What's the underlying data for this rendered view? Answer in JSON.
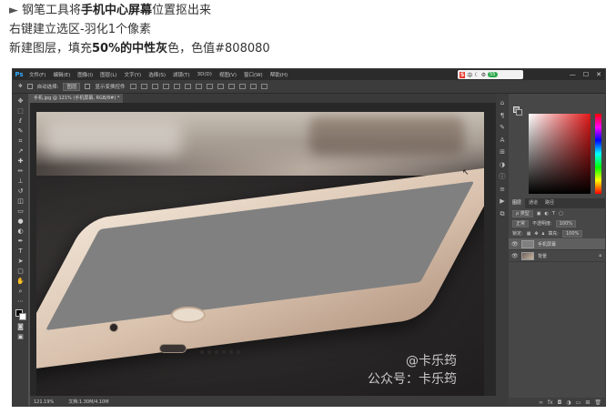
{
  "instructions": {
    "line1_prefix": "钢笔工具将",
    "line1_bold": "手机中心屏幕",
    "line1_suffix": "位置抠出来",
    "line2": "右键建立选区-羽化1个像素",
    "line3_prefix": "新建图层，填充",
    "line3_bold": "50%的中性灰",
    "line3_suffix": "色，色值#808080"
  },
  "app": {
    "logo": "Ps",
    "menu": [
      "文件(F)",
      "编辑(E)",
      "图像(I)",
      "图层(L)",
      "文字(Y)",
      "选择(S)",
      "滤镜(T)",
      "3D(D)",
      "视图(V)",
      "窗口(W)",
      "帮助(H)"
    ],
    "ime_text": "中",
    "ime_badge": "S",
    "ime_bubble": "55"
  },
  "options": {
    "auto_select_label": "自动选择:",
    "auto_select_value": "图层",
    "show_transform": "显示变换控件"
  },
  "document": {
    "tab_title": "手机.jpg @ 121% (手机屏幕, RGB/8#) *",
    "zoom": "121.19%",
    "doc_size": "文档:1.30M/4.10M"
  },
  "watermark": {
    "line1": "@卡乐筠",
    "line2": "公众号：卡乐筠"
  },
  "layers_panel": {
    "tabs": [
      "图层",
      "通道",
      "路径"
    ],
    "kind_label": "ρ 类型",
    "blend_mode": "正常",
    "opacity_label": "不透明度:",
    "opacity_value": "100%",
    "lock_label": "锁定:",
    "fill_label": "填充:",
    "fill_value": "100%",
    "layers": [
      {
        "name": "手机屏幕",
        "active": true
      },
      {
        "name": "背景",
        "active": false
      }
    ]
  },
  "colors": {
    "neutral_gray": "#808080",
    "fill_percent": 50
  }
}
